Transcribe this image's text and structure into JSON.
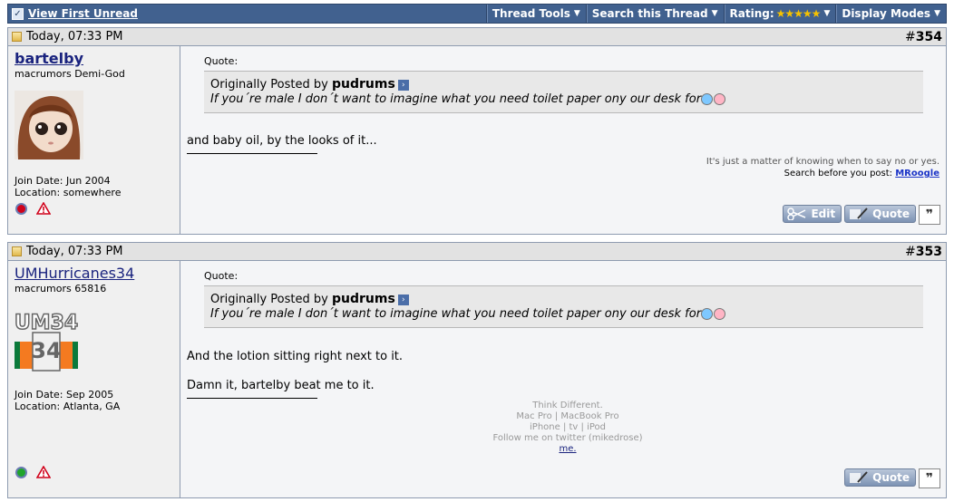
{
  "toolbar": {
    "view_first_unread": "View First Unread",
    "thread_tools": "Thread Tools",
    "search_thread": "Search this Thread",
    "rating_label": "Rating:",
    "rating_stars": "★★★★★",
    "display_modes": "Display Modes"
  },
  "posts": [
    {
      "date": "Today, 07:33 PM",
      "number": "354",
      "username": "bartelby",
      "usertitle": "macrumors Demi-God",
      "join_date": "Join Date: Jun 2004",
      "location": "Location: somewhere",
      "status": "offline",
      "status_color": "#d0021b",
      "quote_label": "Quote:",
      "quote_prefix": "Originally Posted by",
      "quote_author": "pudrums",
      "quote_text": "If you´re male I don´t want to imagine what you need toilet paper ony our desk for",
      "message_lines": [
        "and baby oil, by the looks of it..."
      ],
      "signature_lines": [
        "It's just a matter of knowing when to say no or yes."
      ],
      "signature_prefix": "Search before you post:",
      "signature_link": "MRoogle",
      "edit_label": "Edit",
      "quote_button": "Quote"
    },
    {
      "date": "Today, 07:33 PM",
      "number": "353",
      "username": "UMHurricanes34",
      "usertitle": "macrumors 65816",
      "join_date": "Join Date: Sep 2005",
      "location": "Location: Atlanta, GA",
      "status": "online",
      "status_color": "#1fa52b",
      "quote_label": "Quote:",
      "quote_prefix": "Originally Posted by",
      "quote_author": "pudrums",
      "quote_text": "If you´re male I don´t want to imagine what you need toilet paper ony our desk for",
      "message_lines": [
        "And the lotion sitting right next to it.",
        "Damn it, bartelby beat me to it."
      ],
      "signature_lines": [
        "Think Different.",
        "Mac Pro | MacBook Pro",
        "iPhone | tv | iPod",
        "Follow me on twitter (mikedrose)"
      ],
      "signature_link": "me.",
      "quote_button": "Quote"
    }
  ],
  "avatar2_text": "UM34"
}
